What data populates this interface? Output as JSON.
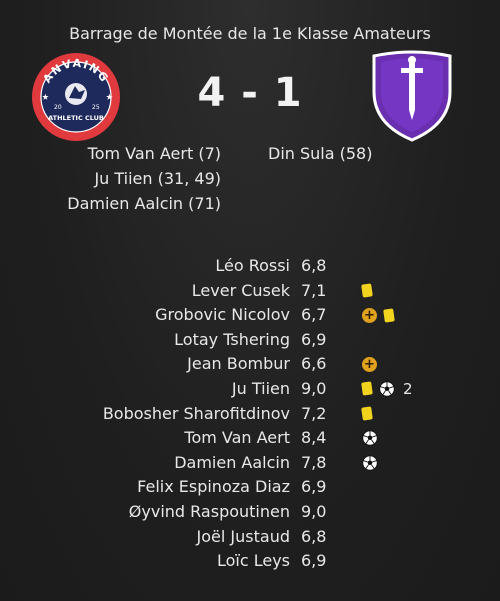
{
  "match": {
    "title": "Barrage de Montée de la 1e Klasse Amateurs",
    "score": "4 - 1",
    "home_crest": {
      "name": "ANVAING",
      "year_left": "20",
      "year_right": "25",
      "banner": "ATHLETIC CLUB"
    }
  },
  "home_scorers": [
    "Tom Van Aert (7)",
    "Ju Tiien (31, 49)",
    "Damien Aalcin (71)"
  ],
  "away_scorers": [
    "Din Sula (58)"
  ],
  "players": [
    {
      "name": "Léo Rossi",
      "rating": "6,8",
      "icons": []
    },
    {
      "name": "Lever Cusek",
      "rating": "7,1",
      "icons": [
        "yellow-card"
      ]
    },
    {
      "name": "Grobovic Nicolov",
      "rating": "6,7",
      "icons": [
        "sub",
        "yellow-card"
      ]
    },
    {
      "name": "Lotay Tshering",
      "rating": "6,9",
      "icons": []
    },
    {
      "name": "Jean Bombur",
      "rating": "6,6",
      "icons": [
        "sub"
      ]
    },
    {
      "name": "Ju Tiien",
      "rating": "9,0",
      "icons": [
        "yellow-card",
        "goal"
      ],
      "goals_label": "2"
    },
    {
      "name": "Bobosher Sharofitdinov",
      "rating": "7,2",
      "icons": [
        "yellow-card"
      ]
    },
    {
      "name": "Tom Van Aert",
      "rating": "8,4",
      "icons": [
        "goal"
      ]
    },
    {
      "name": "Damien Aalcin",
      "rating": "7,8",
      "icons": [
        "goal"
      ]
    },
    {
      "name": "Felix Espinoza Diaz",
      "rating": "6,9",
      "icons": []
    },
    {
      "name": "Øyvind Raspoutinen",
      "rating": "9,0",
      "icons": []
    },
    {
      "name": "Joël Justaud",
      "rating": "6,8",
      "icons": []
    },
    {
      "name": "Loïc Leys",
      "rating": "6,9",
      "icons": []
    }
  ],
  "colors": {
    "yellow_card": "#f2d41f",
    "sub": "#e0a11d",
    "home_red": "#e03a3e",
    "home_navy": "#1f2a5c",
    "away_purple": "#6a2fb0"
  }
}
